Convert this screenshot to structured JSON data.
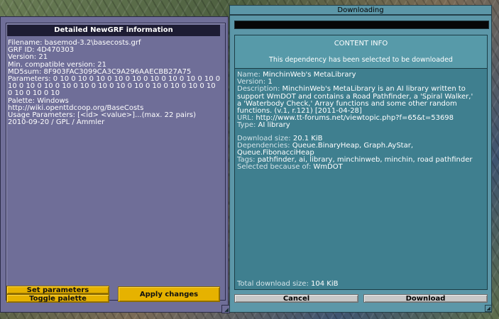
{
  "newgrf_panel": {
    "title": "Detailed NewGRF information",
    "filename_label": "Filename:",
    "filename": "basemod-3.2\\basecosts.grf",
    "grfid_label": "GRF ID:",
    "grfid": "4D470303",
    "version_label": "Version:",
    "version": "21",
    "min_version_label": "Min. compatible version:",
    "min_version": "21",
    "md5_label": "MD5sum:",
    "md5": "8F903FAC3099CA3C9A296AAECBB27A75",
    "parameters_label": "Parameters:",
    "parameters": "0 10 0 10 0 10 0 10 0 10 0 10 0 10 0 10 0 10 0 10 0 10 0 10 0 10 0 10 0 10 0 10 0 10 0 10 0 10 0 10 0 10 0 10 0 10 0 10",
    "palette_label": "Palette:",
    "palette": "Windows",
    "url": "http://wiki.openttdcoop.org/BaseCosts",
    "usage_label": "Usage Parameters:",
    "usage": "[<id> <value>]...(max. 22 pairs)",
    "date_license": "2010-09-20 / GPL / Ammler",
    "set_parameters_label": "Set parameters",
    "toggle_palette_label": "Toggle palette",
    "apply_changes_label": "Apply changes"
  },
  "download_window": {
    "title": "Downloading",
    "progress_fraction": 0.0,
    "content_info_title": "CONTENT INFO",
    "selection_note": "This dependency has been selected to be downloaded",
    "name_label": "Name:",
    "name": "MinchinWeb's MetaLibrary",
    "version_label": "Version:",
    "version": "1",
    "description_label": "Description:",
    "description_lines": [
      "MinchinWeb's MetaLibrary is an AI library written to",
      "support WmDOT and contains a Road Pathfinder, a 'Spiral Walker,'",
      "a 'Waterbody Check,' Array functions and some other random",
      "functions. (v.1, r.121) [2011-04-28]"
    ],
    "url_label": "URL:",
    "url": "http://www.tt-forums.net/viewtopic.php?f=65&t=53698",
    "type_label": "Type:",
    "type": "AI library",
    "download_size_label": "Download size:",
    "download_size": "20.1 KiB",
    "dependencies_label": "Dependencies:",
    "dependencies_lines": [
      "Queue.BinaryHeap, Graph.AyStar,",
      "Queue.FibonacciHeap"
    ],
    "tags_label": "Tags:",
    "tags": "pathfinder, ai, library, minchinweb, minchin, road pathfinder",
    "selected_because_label": "Selected because of:",
    "selected_because": "WmDOT",
    "total_size_label": "Total download size:",
    "total_size": "104 KiB",
    "cancel_label": "Cancel",
    "download_label": "Download"
  },
  "colors": {
    "left_window": "#6f6e98",
    "right_window": "#5c97a8",
    "content_panel": "#3f7f8f",
    "button_yellow": "#e6b200",
    "button_grey": "#c8c8c8"
  }
}
